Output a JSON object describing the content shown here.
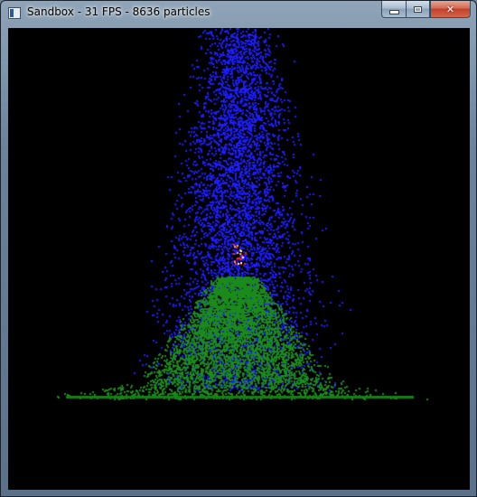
{
  "window": {
    "title": "Sandbox - 31 FPS - 8636 particles",
    "icon": "application-icon"
  },
  "caption_buttons": {
    "minimize": "minimize-icon",
    "maximize": "maximize-icon",
    "close": "close-icon",
    "close_glyph": "✕"
  },
  "colors": {
    "background": "#000000",
    "water": "#1c1cff",
    "plant": "#1a8a1a",
    "ground": "#158015",
    "fire_red": "#ff2a10",
    "fire_orange": "#ffb030",
    "spark": "#ffffff"
  }
}
